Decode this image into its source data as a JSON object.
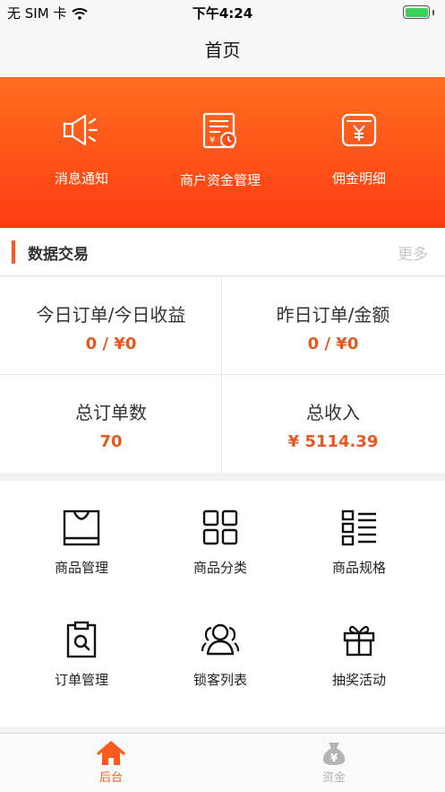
{
  "status_bar": {
    "carrier": "无 SIM 卡",
    "time": "下午4:24"
  },
  "nav": {
    "title": "首页"
  },
  "banner": {
    "items": [
      {
        "label": "消息通知",
        "icon": "megaphone-icon"
      },
      {
        "label": "商户资金管理",
        "icon": "fund-document-icon"
      },
      {
        "label": "佣金明细",
        "icon": "wallet-icon"
      }
    ]
  },
  "section": {
    "title": "数据交易",
    "more": "更多"
  },
  "stats": [
    {
      "label": "今日订单/今日收益",
      "value": "0 / ¥0"
    },
    {
      "label": "昨日订单/金额",
      "value": "0 / ¥0"
    },
    {
      "label": "总订单数",
      "value": "70"
    },
    {
      "label": "总收入",
      "value": "¥ 5114.39"
    }
  ],
  "menu": [
    {
      "label": "商品管理",
      "icon": "shopping-bag-icon"
    },
    {
      "label": "商品分类",
      "icon": "category-grid-icon"
    },
    {
      "label": "商品规格",
      "icon": "list-icon"
    },
    {
      "label": "订单管理",
      "icon": "order-clipboard-icon"
    },
    {
      "label": "锁客列表",
      "icon": "customers-icon"
    },
    {
      "label": "抽奖活动",
      "icon": "gift-icon"
    }
  ],
  "tabbar": {
    "items": [
      {
        "label": "后台",
        "icon": "home-icon",
        "active": true
      },
      {
        "label": "资金",
        "icon": "money-bag-icon",
        "active": false
      }
    ]
  },
  "colors": {
    "accent": "#ff5a1e",
    "value_orange": "#e7581f",
    "battery_green": "#3ad25a"
  }
}
